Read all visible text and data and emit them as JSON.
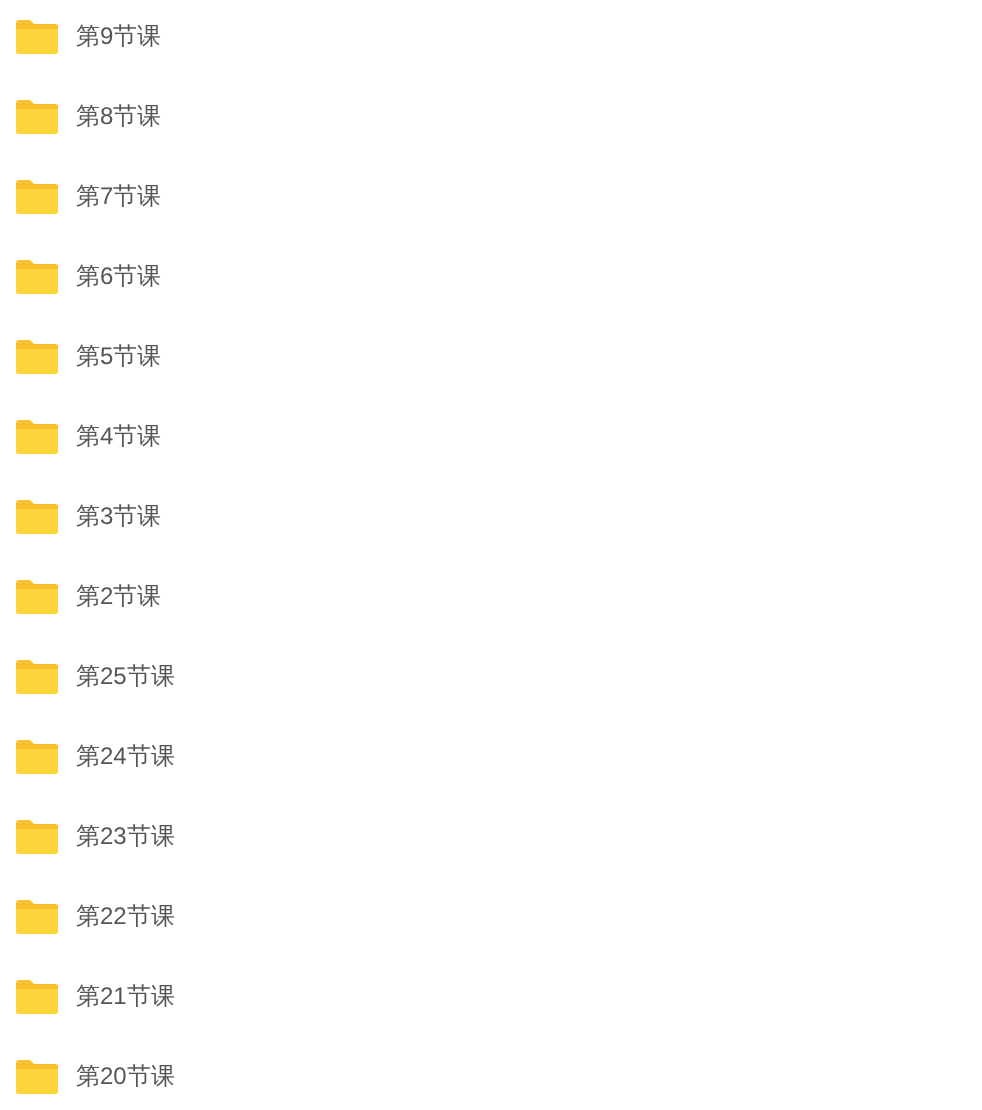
{
  "folders": [
    {
      "name": "第9节课"
    },
    {
      "name": "第8节课"
    },
    {
      "name": "第7节课"
    },
    {
      "name": "第6节课"
    },
    {
      "name": "第5节课"
    },
    {
      "name": "第4节课"
    },
    {
      "name": "第3节课"
    },
    {
      "name": "第2节课"
    },
    {
      "name": "第25节课"
    },
    {
      "name": "第24节课"
    },
    {
      "name": "第23节课"
    },
    {
      "name": "第22节课"
    },
    {
      "name": "第21节课"
    },
    {
      "name": "第20节课"
    }
  ]
}
